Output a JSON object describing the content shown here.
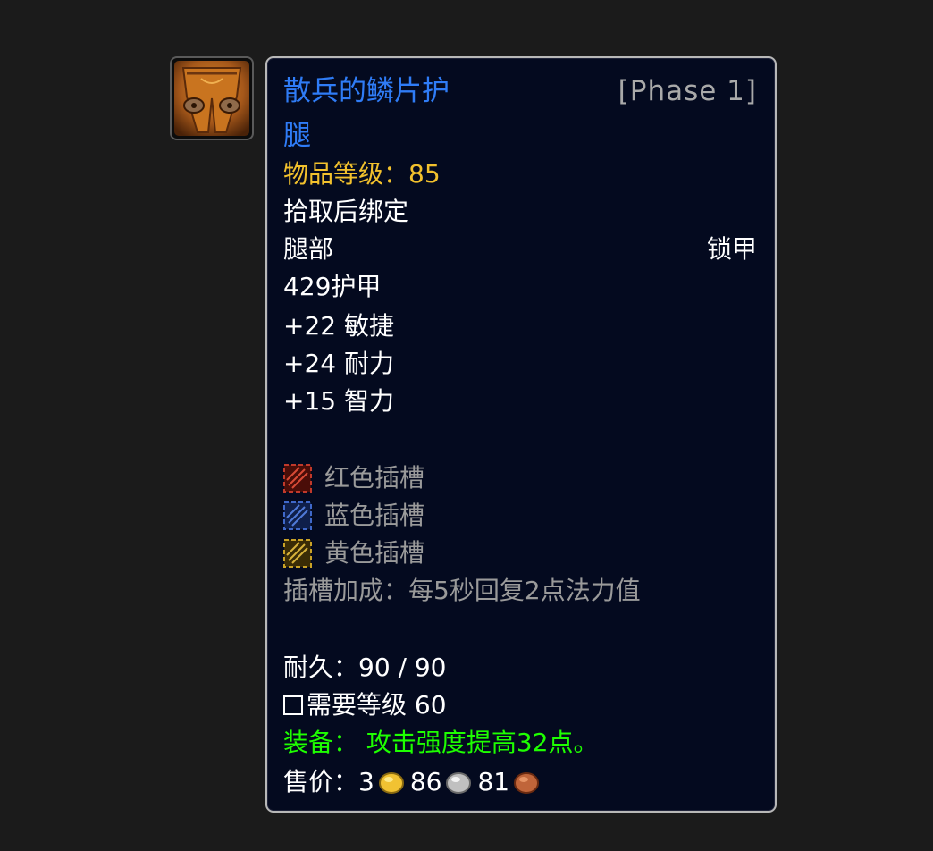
{
  "item": {
    "name_line1": "散兵的鳞片护",
    "name_line2": "腿",
    "phase": "[Phase 1]",
    "item_level": "物品等级：85",
    "bind": "拾取后绑定",
    "slot": "腿部",
    "armor_type": "锁甲",
    "armor": "429护甲",
    "stats": [
      "+22 敏捷",
      "+24 耐力",
      "+15 智力"
    ],
    "sockets": [
      {
        "label": "红色插槽",
        "color": "#c0392b",
        "icon": "red-socket-icon"
      },
      {
        "label": "蓝色插槽",
        "color": "#3f68c9",
        "icon": "blue-socket-icon"
      },
      {
        "label": "黄色插槽",
        "color": "#c9a227",
        "icon": "yellow-socket-icon"
      }
    ],
    "socket_bonus": "插槽加成：每5秒回复2点法力值",
    "durability": "耐久：90 / 90",
    "required_level": "需要等级 60",
    "equip": "装备：  攻击强度提高32点。",
    "sell_label": "售价：",
    "sell_gold": "3",
    "sell_silver": "86",
    "sell_copper": "81"
  },
  "colors": {
    "title": "#2f7cf6",
    "item_level": "#f2c12d",
    "socket_text": "#9a9a9a",
    "equip": "#1eff00",
    "gold_coin": "#f1c232",
    "silver_coin": "#c0c0c0",
    "copper_coin": "#c0653a"
  }
}
